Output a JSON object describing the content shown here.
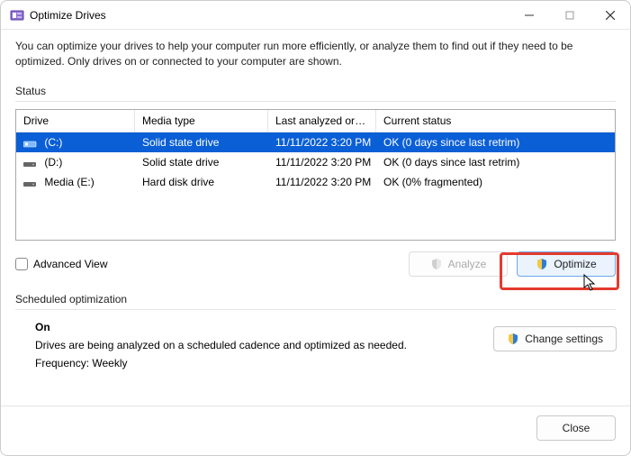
{
  "window": {
    "title": "Optimize Drives"
  },
  "intro": "You can optimize your drives to help your computer run more efficiently, or analyze them to find out if they need to be optimized. Only drives on or connected to your computer are shown.",
  "status_label": "Status",
  "columns": {
    "drive": "Drive",
    "media": "Media type",
    "last": "Last analyzed or o...",
    "status": "Current status"
  },
  "drives": [
    {
      "name": "(C:)",
      "media": "Solid state drive",
      "last": "11/11/2022 3:20 PM",
      "status": "OK (0 days since last retrim)",
      "selected": true,
      "icon": "ssd"
    },
    {
      "name": "(D:)",
      "media": "Solid state drive",
      "last": "11/11/2022 3:20 PM",
      "status": "OK (0 days since last retrim)",
      "selected": false,
      "icon": "hdd"
    },
    {
      "name": "Media (E:)",
      "media": "Hard disk drive",
      "last": "11/11/2022 3:20 PM",
      "status": "OK (0% fragmented)",
      "selected": false,
      "icon": "hdd"
    }
  ],
  "advanced_view_label": "Advanced View",
  "buttons": {
    "analyze": "Analyze",
    "optimize": "Optimize",
    "change_settings": "Change settings",
    "close": "Close"
  },
  "scheduled": {
    "heading": "Scheduled optimization",
    "state": "On",
    "desc": "Drives are being analyzed on a scheduled cadence and optimized as needed.",
    "frequency": "Frequency: Weekly"
  }
}
